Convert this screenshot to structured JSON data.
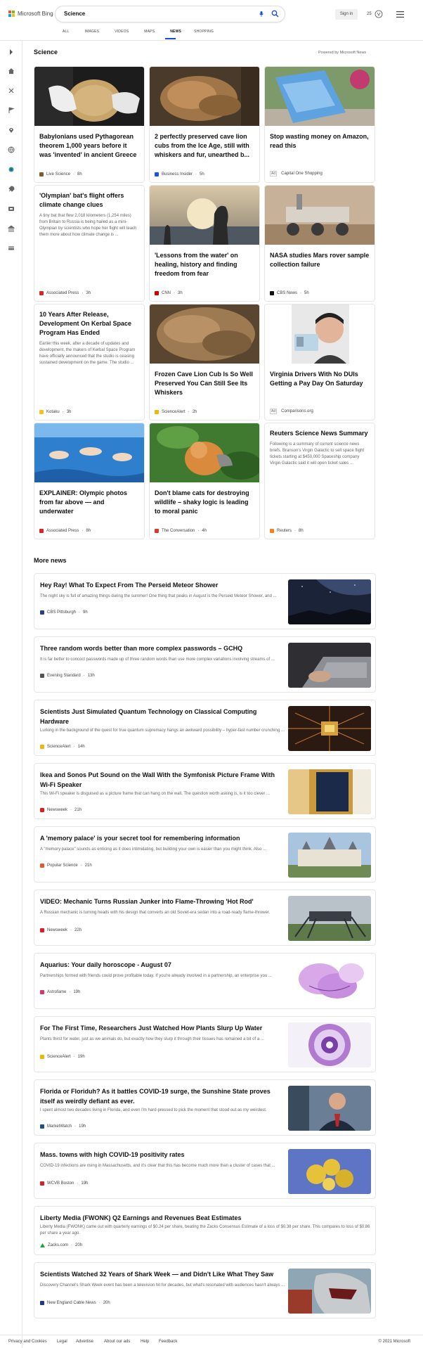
{
  "header": {
    "brand": "Microsoft Bing",
    "brand_colors": [
      "#f35325",
      "#81bc06",
      "#05a6f0",
      "#ffba08"
    ],
    "search_value": "Science",
    "tabs": [
      {
        "label": "ALL"
      },
      {
        "label": "IMAGES"
      },
      {
        "label": "VIDEOS"
      },
      {
        "label": "MAPS"
      },
      {
        "label": "NEWS",
        "active": true
      },
      {
        "label": "SHOPPING"
      }
    ],
    "sign_in": "Sign in",
    "rewards_count": "25",
    "accent": "#174ae4"
  },
  "rail": {
    "icons": [
      "chevron-right-icon",
      "home-icon",
      "tools-icon",
      "flag-icon",
      "location-icon",
      "globe-icon",
      "science-icon",
      "rocket-icon",
      "tv-icon",
      "bank-icon",
      "card-icon"
    ]
  },
  "section": {
    "title": "Science",
    "powered_by": "Powered by Microsoft News"
  },
  "cards": [
    {
      "title": "Babylonians used Pythagorean theorem 1,000 years before it was 'invented' in ancient Greece",
      "excerpt": "",
      "source": "Live Science",
      "age": "8h",
      "ad": false,
      "image": "tablet-photo",
      "logo_color": "#7a5c2e"
    },
    {
      "title": "2 perfectly preserved cave lion cubs from the Ice Age, still with whiskers and fur, unearthed b...",
      "excerpt": "",
      "source": "Business Insider",
      "age": "5h",
      "ad": false,
      "image": "lion-cub-photo",
      "logo_color": "#1a56db"
    },
    {
      "title": "Stop wasting money on Amazon, read this",
      "excerpt": "",
      "source": "Capital One Shopping",
      "age": "",
      "ad": true,
      "ad_label": "Ad",
      "image": "amazon-package-photo",
      "logo_color": ""
    },
    {
      "title": "'Olympian' bat's flight offers climate change clues",
      "excerpt": "A tiny bat that flew 2,018 kilometers (1,254 miles) from Britain to Russia is being hailed as a mini-Olympian by scientists who hope her flight will teach them more about how climate change is ...",
      "source": "Associated Press",
      "age": "3h",
      "ad": false,
      "image": "",
      "logo_color": "#d92626"
    },
    {
      "title": "'Lessons from the water' on healing, history and finding freedom from fear",
      "excerpt": "",
      "source": "CNN",
      "age": "3h",
      "ad": false,
      "image": "beach-silhouette-photo",
      "logo_color": "#cc0000"
    },
    {
      "title": "NASA studies Mars rover sample collection failure",
      "excerpt": "",
      "source": "CBS News",
      "age": "5h",
      "ad": false,
      "image": "mars-rover-photo",
      "logo_color": "#111111"
    },
    {
      "title": "10 Years After Release, Development On Kerbal Space Program Has Ended",
      "excerpt": "Earlier this week, after a decade of updates and development, the makers of Kerbal Space Program have officially announced that the studio is ceasing sustained development on the game. The studio ...",
      "source": "Kotaku",
      "age": "3h",
      "ad": false,
      "image": "",
      "logo_color": "#f2c318"
    },
    {
      "title": "Frozen Cave Lion Cub Is So Well Preserved You Can Still See Its Whiskers",
      "excerpt": "",
      "source": "ScienceAlert",
      "age": "2h",
      "ad": false,
      "image": "lion-fur-photo",
      "logo_color": "#f2b705"
    },
    {
      "title": "Virginia Drivers With No DUIs Getting a Pay Day On Saturday",
      "excerpt": "",
      "source": "Comparisons.org",
      "age": "",
      "ad": true,
      "ad_label": "Ad",
      "image": "man-with-license-photo",
      "logo_color": ""
    },
    {
      "title": "EXPLAINER: Olympic photos from far above — and underwater",
      "excerpt": "",
      "source": "Associated Press",
      "age": "8h",
      "ad": false,
      "image": "swimmers-photo",
      "logo_color": "#d92626"
    },
    {
      "title": "Don't blame cats for destroying wildlife – shaky logic is leading to moral panic",
      "excerpt": "",
      "source": "The Conversation",
      "age": "4h",
      "ad": false,
      "image": "cat-photo",
      "logo_color": "#d83a32"
    },
    {
      "title": "Reuters Science News Summary",
      "excerpt": "Following is a summary of current science news briefs. Branson's Virgin Galactic to sell space flight tickets starting at $450,000 Spaceship company Virgin Galactic said it will open ticket sales ...",
      "source": "Reuters",
      "age": "8h",
      "ad": false,
      "image": "",
      "logo_color": "#f5821f"
    }
  ],
  "more_news": {
    "title": "More news",
    "items": [
      {
        "title": "Hey Ray! What To Expect From The Perseid Meteor Shower",
        "excerpt": "The night sky is full of amazing things during the summer! One thing that peaks in August is the Perseid Meteor Shower, and ...",
        "source": "CBS Pittsburgh",
        "age": "9h",
        "logo_color": "#2b3e8c"
      },
      {
        "title": "Three random words better than more complex passwords – GCHQ",
        "excerpt": "It is far better to concoct passwords made up of three random words than use more complex variations involving streams of ...",
        "source": "Evening Standard",
        "age": "13h",
        "logo_color": "#555555"
      },
      {
        "title": "Scientists Just Simulated Quantum Technology on Classical Computing Hardware",
        "excerpt": "Lurking in the background of the quest for true quantum supremacy hangs an awkward possibility – hyper-fast number crunching ...",
        "source": "ScienceAlert",
        "age": "14h",
        "logo_color": "#f2b705"
      },
      {
        "title": "Ikea and Sonos Put Sound on the Wall With the Symfonisk Picture Frame With Wi-Fi Speaker",
        "excerpt": "This Wi-Fi speaker is disguised as a picture frame that can hang on the wall. The question worth asking is, is it too clever ...",
        "source": "Newsweek",
        "age": "21h",
        "logo_color": "#e21b23"
      },
      {
        "title": "A 'memory palace' is your secret tool for remembering information",
        "excerpt": "A \"memory palace\" sounds as enticing as it does intimidating, but building your own is easier than you might think. Also ...",
        "source": "Popular Science",
        "age": "21h",
        "logo_color": "#e05a2b"
      },
      {
        "title": "VIDEO: Mechanic Turns Russian Junker into Flame-Throwing 'Hot Rod'",
        "excerpt": "A Russian mechanic is turning heads with his design that converts an old Soviet-era sedan into a road-ready flame-thrower.",
        "source": "Newsweek",
        "age": "22h",
        "logo_color": "#e21b23"
      },
      {
        "title": "Aquarius: Your daily horoscope - August 07",
        "excerpt": "Partnerships formed with friends could prove profitable today. If you're already involved in a partnership, an enterprise you ...",
        "source": "Astrofame",
        "age": "19h",
        "logo_color": "#d8336b"
      },
      {
        "title": "For The First Time, Researchers Just Watched How Plants Slurp Up Water",
        "excerpt": "Plants thirst for water, just as we animals do, but exactly how they slurp it through their tissues has remained a bit of a ...",
        "source": "ScienceAlert",
        "age": "19h",
        "logo_color": "#f2b705"
      },
      {
        "title": "Florida or Floriduh? As it battles COVID-19 surge, the Sunshine State proves itself as weirdly defiant as ever.",
        "excerpt": "I spent almost two decades living in Florida, and even I'm hard-pressed to pick the moment that stood out as my weirdest.",
        "source": "MarketWatch",
        "age": "19h",
        "logo_color": "#1f4e8c"
      },
      {
        "title": "Mass. towns with high COVID-19 positivity rates",
        "excerpt": "COVID-19 infections are rising in Massachusetts, and it's clear that this has become much more than a cluster of cases that ...",
        "source": "WCVB Boston",
        "age": "19h",
        "logo_color": "#d71f26"
      },
      {
        "title": "Liberty Media (FWONK) Q2 Earnings and Revenues Beat Estimates",
        "excerpt": "Liberty Media (FWONK) came out with quarterly earnings of $0.24 per share, beating the Zacks Consensus Estimate of a loss of $0.38 per share. This compares to loss of $0.86 per share a year ago.",
        "source": "Zacks.com",
        "age": "20h",
        "logo_color": "#21a33a"
      },
      {
        "title": "Scientists Watched 32 Years of Shark Week — and Didn't Like What They Saw",
        "excerpt": "Discovery Channel's Shark Week event has been a television hit for decades, but what's resonated with audiences hasn't always ...",
        "source": "New England Cable News",
        "age": "20h",
        "logo_color": "#1f3a8c"
      }
    ]
  },
  "footer": {
    "links": [
      "Privacy and Cookies",
      "Legal",
      "Advertise",
      "About our ads",
      "Help",
      "Feedback"
    ],
    "copyright": "© 2021 Microsoft"
  }
}
